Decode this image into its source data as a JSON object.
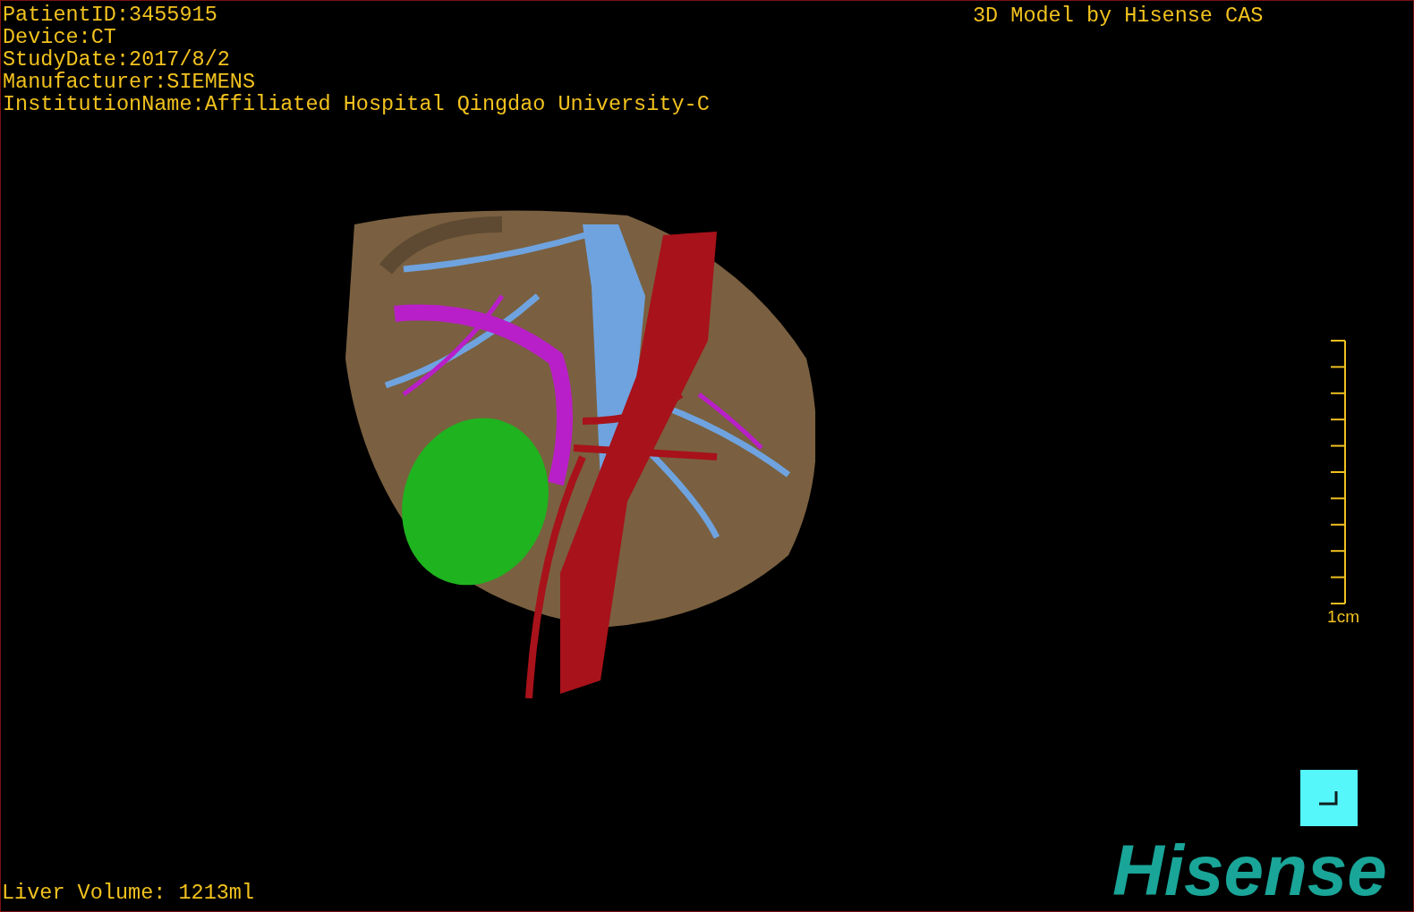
{
  "overlay": {
    "info_lines": [
      "PatientID:3455915",
      "Device:CT",
      "StudyDate:2017/8/2",
      "Manufacturer:SIEMENS",
      "InstitutionName:Affiliated Hospital Qingdao University-C"
    ],
    "credit": "3D Model by Hisense CAS",
    "scale_label": "1cm",
    "volume": "Liver Volume: 1213ml",
    "logo": "Hisense"
  }
}
